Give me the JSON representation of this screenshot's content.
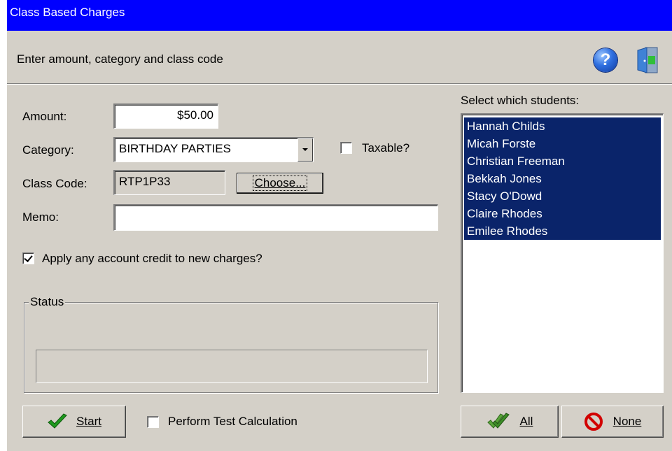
{
  "window": {
    "title": "Class Based Charges"
  },
  "header": {
    "hint": "Enter amount, category and class code",
    "help_icon": "help-icon",
    "exit_icon": "exit-door-icon"
  },
  "form": {
    "amount_label": "Amount:",
    "amount_value": "$50.00",
    "category_label": "Category:",
    "category_value": "BIRTHDAY PARTIES",
    "taxable_label": "Taxable?",
    "taxable_checked": false,
    "class_code_label": "Class Code:",
    "class_code_value": "RTP1P33",
    "choose_label": "Choose...",
    "memo_label": "Memo:",
    "memo_value": "",
    "apply_credit_label": "Apply any account credit to new charges?",
    "apply_credit_checked": true
  },
  "status": {
    "legend": "Status",
    "progress": 0
  },
  "actions": {
    "start_label": "Start",
    "test_calc_label": "Perform Test Calculation",
    "test_calc_checked": false
  },
  "students": {
    "heading": "Select which students:",
    "items": [
      "Hannah Childs",
      "Micah Forste",
      "Christian Freeman",
      "Bekkah Jones",
      "Stacy O'Dowd",
      "Claire Rhodes",
      "Emilee Rhodes"
    ],
    "all_label": "All",
    "none_label": "None"
  },
  "colors": {
    "titlebar": "#0000ff",
    "selection": "#0a246a",
    "face": "#d4d0c8"
  }
}
